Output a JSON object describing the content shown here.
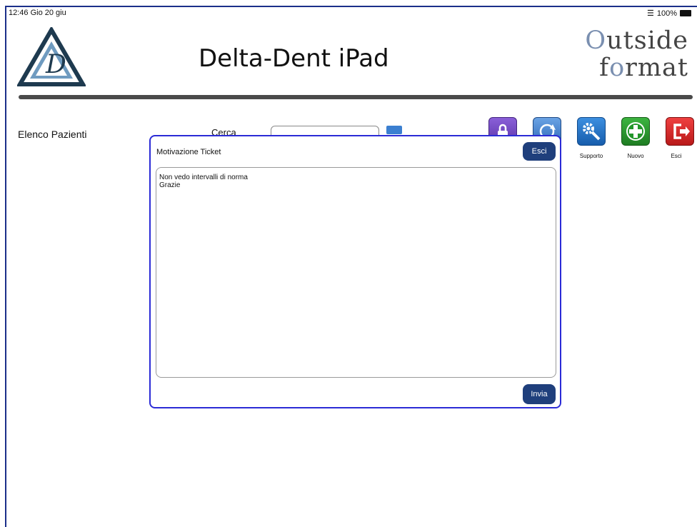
{
  "status_bar": {
    "time": "12:46",
    "date": "Gio 20 giu",
    "battery": "100%"
  },
  "header": {
    "title": "Delta-Dent iPad",
    "brand_line1": "utside",
    "brand_line2": "rmat"
  },
  "sidebar": {
    "label": "Elenco Pazienti"
  },
  "search": {
    "label": "Cerca",
    "value": ""
  },
  "toolbar": [
    {
      "label": ""
    },
    {
      "label": ""
    },
    {
      "label": "Supporto"
    },
    {
      "label": "Nuovo"
    },
    {
      "label": "Esci"
    }
  ],
  "modal": {
    "title": "Motivazione Ticket",
    "close_label": "Esci",
    "message": "Non vedo intervalli di norma\nGrazie",
    "send_label": "Invia"
  },
  "colors": {
    "frame": "#1b2f8a",
    "modal_border": "#2b2bd6",
    "button_dark": "#1f3f7c"
  }
}
